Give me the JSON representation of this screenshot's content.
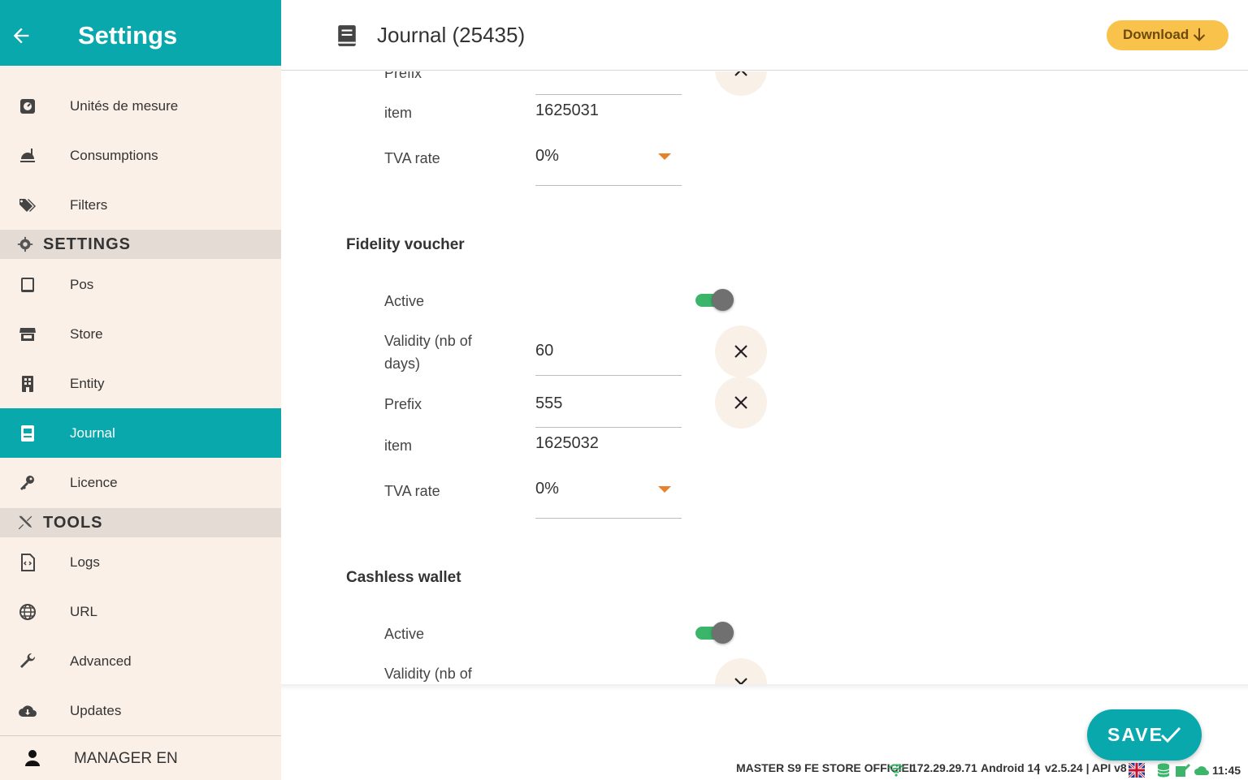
{
  "sidebar": {
    "title": "Settings",
    "items_top": [
      {
        "label": "Unités de mesure",
        "icon": "gauge-icon"
      },
      {
        "label": "Consumptions",
        "icon": "food-icon"
      },
      {
        "label": "Filters",
        "icon": "tags-icon"
      }
    ],
    "section_settings": "SETTINGS",
    "items_settings": [
      {
        "label": "Pos",
        "icon": "tablet-icon"
      },
      {
        "label": "Store",
        "icon": "store-icon"
      },
      {
        "label": "Entity",
        "icon": "building-icon"
      },
      {
        "label": "Journal",
        "icon": "journal-icon",
        "active": true
      },
      {
        "label": "Licence",
        "icon": "key-icon"
      }
    ],
    "section_tools": "TOOLS",
    "items_tools": [
      {
        "label": "Logs",
        "icon": "file-code-icon"
      },
      {
        "label": "URL",
        "icon": "globe-icon"
      },
      {
        "label": "Advanced",
        "icon": "wrench-icon"
      },
      {
        "label": "Updates",
        "icon": "cloud-download-icon"
      }
    ],
    "user": "MANAGER EN"
  },
  "header": {
    "title": "Journal (25435)",
    "download_label": "Download"
  },
  "form": {
    "partial_prefix_label": "Prefix",
    "block1": {
      "item_label": "item",
      "item_value": "1625031",
      "tva_label": "TVA rate",
      "tva_value": "0%"
    },
    "fidelity": {
      "title": "Fidelity voucher",
      "active_label": "Active",
      "active": true,
      "validity_label_1": "Validity (nb of",
      "validity_label_2": "days)",
      "validity_value": "60",
      "prefix_label": "Prefix",
      "prefix_value": "555",
      "item_label": "item",
      "item_value": "1625032",
      "tva_label": "TVA rate",
      "tva_value": "0%"
    },
    "cashless": {
      "title": "Cashless wallet",
      "active_label": "Active",
      "active": true,
      "validity_label_1": "Validity (nb of"
    }
  },
  "save_label": "SAVE",
  "status_bar": {
    "store": "MASTER S9 FE STORE OFFICIEL",
    "ip": "172.29.29.71",
    "android": "Android 14",
    "version": "v2.5.24 | API v8",
    "time": "11:45"
  },
  "colors": {
    "accent": "#09a8ad",
    "download": "#f9c24a",
    "toggle_on": "#3bb56a",
    "sidebar_bg": "#fbf0e8",
    "arrow": "#e8822a"
  }
}
